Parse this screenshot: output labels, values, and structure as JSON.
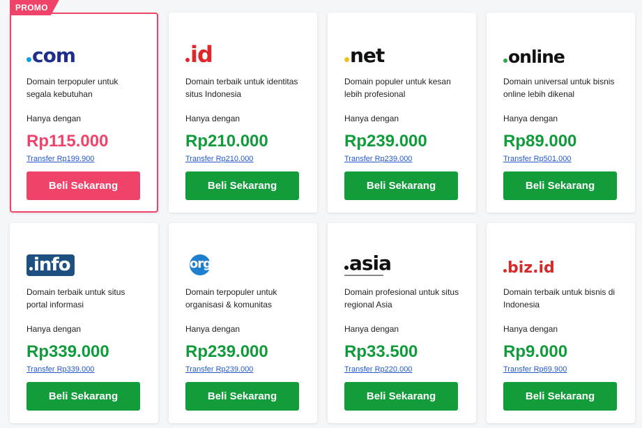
{
  "promo_label": "PROMO",
  "colors": {
    "green": "#129c3a",
    "pink": "#f0436a",
    "link": "#2459c9"
  },
  "cards": [
    {
      "ext": ".com",
      "dot_color": "#0aa0e2",
      "text_color": "#1f2e8a",
      "desc": "Domain terpopuler untuk segala kebutuhan",
      "from_label": "Hanya dengan",
      "price": "Rp115.000",
      "transfer": "Transfer Rp199.900",
      "button": "Beli Sekarang",
      "promo": true
    },
    {
      "ext": ".id",
      "dot_color": "#e0262a",
      "text_color": "#e0262a",
      "desc": "Domain terbaik untuk identitas situs Indonesia",
      "from_label": "Hanya dengan",
      "price": "Rp210.000",
      "transfer": "Transfer Rp210.000",
      "button": "Beli Sekarang",
      "promo": false
    },
    {
      "ext": ".net",
      "dot_color": "#f2c01a",
      "text_color": "#111111",
      "desc": "Domain populer untuk kesan lebih profesional",
      "from_label": "Hanya dengan",
      "price": "Rp239.000",
      "transfer": "Transfer Rp239.000",
      "button": "Beli Sekarang",
      "promo": false
    },
    {
      "ext": ".online",
      "dot_color": "#2ea84a",
      "text_color": "#111111",
      "desc": "Domain universal untuk bisnis online lebih dikenal",
      "from_label": "Hanya dengan",
      "price": "Rp89.000",
      "transfer": "Transfer Rp501.000",
      "button": "Beli Sekarang",
      "promo": false
    },
    {
      "ext": ".info",
      "dot_color": "#ffffff",
      "text_color": "#ffffff",
      "desc": "Domain terbaik untuk situs portal informasi",
      "from_label": "Hanya dengan",
      "price": "Rp339.000",
      "transfer": "Transfer Rp339.000",
      "button": "Beli Sekarang",
      "promo": false
    },
    {
      "ext": ".org",
      "dot_color": "#1e7fcf",
      "text_color": "#1d5a9c",
      "desc": "Domain terpopuler untuk organisasi & komunitas",
      "from_label": "Hanya dengan",
      "price": "Rp239.000",
      "transfer": "Transfer Rp239.000",
      "button": "Beli Sekarang",
      "promo": false
    },
    {
      "ext": ".asia",
      "dot_color": "#111111",
      "text_color": "#111111",
      "desc": "Domain profesional untuk situs regional Asia",
      "from_label": "Hanya dengan",
      "price": "Rp33.500",
      "transfer": "Transfer Rp220.000",
      "button": "Beli Sekarang",
      "promo": false
    },
    {
      "ext": ".biz.id",
      "dot_color": "#e0262a",
      "text_color": "#d42a2a",
      "desc": "Domain terbaik untuk bisnis di Indonesia",
      "from_label": "Hanya dengan",
      "price": "Rp9.000",
      "transfer": "Transfer Rp69.900",
      "button": "Beli Sekarang",
      "promo": false
    }
  ]
}
